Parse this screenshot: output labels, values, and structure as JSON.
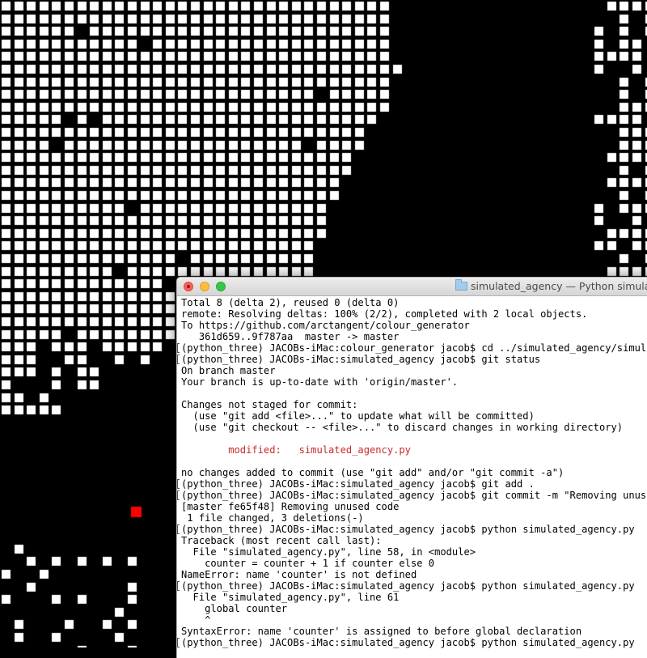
{
  "colors": {
    "background": "#000000",
    "cell_on": "#ffffff",
    "agent": "#ff0000",
    "terminal_bg": "#ffffff",
    "terminal_text": "#000000",
    "modified_text": "#c82b2b"
  },
  "simulation": {
    "description_icon": "grid-cells",
    "agent_label": "agent"
  },
  "window": {
    "title": "simulated_agency — Python simulate",
    "folder_icon": "folder-icon",
    "buttons": [
      "close",
      "minimize",
      "zoom"
    ]
  },
  "terminal": {
    "lines": [
      {
        "text": "Total 8 (delta 2), reused 0 (delta 0)",
        "style": "normal"
      },
      {
        "text": "remote: Resolving deltas: 100% (2/2), completed with 2 local objects.",
        "style": "normal"
      },
      {
        "text": "To https://github.com/arctangent/colour_generator",
        "style": "normal"
      },
      {
        "text": "   361d659..9f787aa  master -> master",
        "style": "normal"
      },
      {
        "text": "(python_three) JACOBs-iMac:colour_generator jacob$ cd ../simulated_agency/simulated",
        "style": "prompt"
      },
      {
        "text": "(python_three) JACOBs-iMac:simulated_agency jacob$ git status",
        "style": "prompt"
      },
      {
        "text": "On branch master",
        "style": "normal"
      },
      {
        "text": "Your branch is up-to-date with 'origin/master'.",
        "style": "normal"
      },
      {
        "text": "",
        "style": "normal"
      },
      {
        "text": "Changes not staged for commit:",
        "style": "normal"
      },
      {
        "text": "  (use \"git add <file>...\" to update what will be committed)",
        "style": "normal"
      },
      {
        "text": "  (use \"git checkout -- <file>...\" to discard changes in working directory)",
        "style": "normal"
      },
      {
        "text": "",
        "style": "normal"
      },
      {
        "text": "        modified:   simulated_agency.py",
        "style": "modified"
      },
      {
        "text": "",
        "style": "normal"
      },
      {
        "text": "no changes added to commit (use \"git add\" and/or \"git commit -a\")",
        "style": "normal"
      },
      {
        "text": "(python_three) JACOBs-iMac:simulated_agency jacob$ git add .",
        "style": "prompt"
      },
      {
        "text": "(python_three) JACOBs-iMac:simulated_agency jacob$ git commit -m \"Removing unused c",
        "style": "prompt"
      },
      {
        "text": "[master fe65f48] Removing unused code",
        "style": "normal"
      },
      {
        "text": " 1 file changed, 3 deletions(-)",
        "style": "normal"
      },
      {
        "text": "(python_three) JACOBs-iMac:simulated_agency jacob$ python simulated_agency.py",
        "style": "prompt"
      },
      {
        "text": "Traceback (most recent call last):",
        "style": "normal"
      },
      {
        "text": "  File \"simulated_agency.py\", line 58, in <module>",
        "style": "normal"
      },
      {
        "text": "    counter = counter + 1 if counter else 0",
        "style": "normal"
      },
      {
        "text": "NameError: name 'counter' is not defined",
        "style": "normal"
      },
      {
        "text": "(python_three) JACOBs-iMac:simulated_agency jacob$ python simulated_agency.py",
        "style": "prompt"
      },
      {
        "text": "  File \"simulated_agency.py\", line 61",
        "style": "normal"
      },
      {
        "text": "    global counter",
        "style": "normal"
      },
      {
        "text": "    ^",
        "style": "normal"
      },
      {
        "text": "SyntaxError: name 'counter' is assigned to before global declaration",
        "style": "normal"
      },
      {
        "text": "(python_three) JACOBs-iMac:simulated_agency jacob$ python simulated_agency.py",
        "style": "prompt"
      }
    ]
  }
}
